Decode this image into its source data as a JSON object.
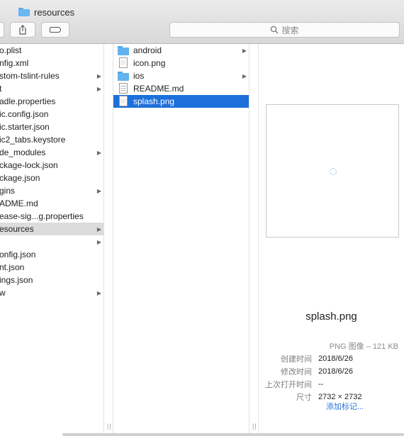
{
  "window": {
    "title": "resources"
  },
  "toolbar": {
    "search_placeholder": "搜索"
  },
  "column1": {
    "items": [
      {
        "label": "o.plist",
        "chevron": false
      },
      {
        "label": "nfig.xml",
        "chevron": false
      },
      {
        "label": "stom-tslint-rules",
        "chevron": true
      },
      {
        "label": "t",
        "chevron": true
      },
      {
        "label": "adle.properties",
        "chevron": false
      },
      {
        "label": "ic.config.json",
        "chevron": false
      },
      {
        "label": "ic.starter.json",
        "chevron": false
      },
      {
        "label": "ic2_tabs.keystore",
        "chevron": false
      },
      {
        "label": "de_modules",
        "chevron": true
      },
      {
        "label": "ckage-lock.json",
        "chevron": false
      },
      {
        "label": "ckage.json",
        "chevron": false
      },
      {
        "label": "gins",
        "chevron": true
      },
      {
        "label": "ADME.md",
        "chevron": false
      },
      {
        "label": "ease-sig...g.properties",
        "chevron": false
      },
      {
        "label": "esources",
        "chevron": true,
        "selected": true
      },
      {
        "label": "",
        "chevron": true
      },
      {
        "label": "onfig.json",
        "chevron": false
      },
      {
        "label": "nt.json",
        "chevron": false
      },
      {
        "label": "ings.json",
        "chevron": false
      },
      {
        "label": "w",
        "chevron": true
      }
    ]
  },
  "column2": {
    "items": [
      {
        "label": "android",
        "icon": "folder-icon",
        "chevron": true
      },
      {
        "label": "icon.png",
        "icon": "image-file-icon",
        "chevron": false
      },
      {
        "label": "ios",
        "icon": "folder-icon",
        "chevron": true
      },
      {
        "label": "README.md",
        "icon": "text-file-icon",
        "chevron": false
      },
      {
        "label": "splash.png",
        "icon": "image-file-icon",
        "chevron": false,
        "selected": true
      }
    ]
  },
  "preview": {
    "filename": "splash.png",
    "kind": "PNG 图像 – 121 KB",
    "info": [
      {
        "key": "创建时间",
        "value": "2018/6/26"
      },
      {
        "key": "修改时间",
        "value": "2018/6/26"
      },
      {
        "key": "上次打开时间",
        "value": "--"
      },
      {
        "key": "尺寸",
        "value": "2732 × 2732"
      }
    ],
    "add_tags": "添加标记..."
  },
  "colors": {
    "selection": "#1d6fdb",
    "folder": "#62b2ef",
    "link": "#2e73d6"
  }
}
